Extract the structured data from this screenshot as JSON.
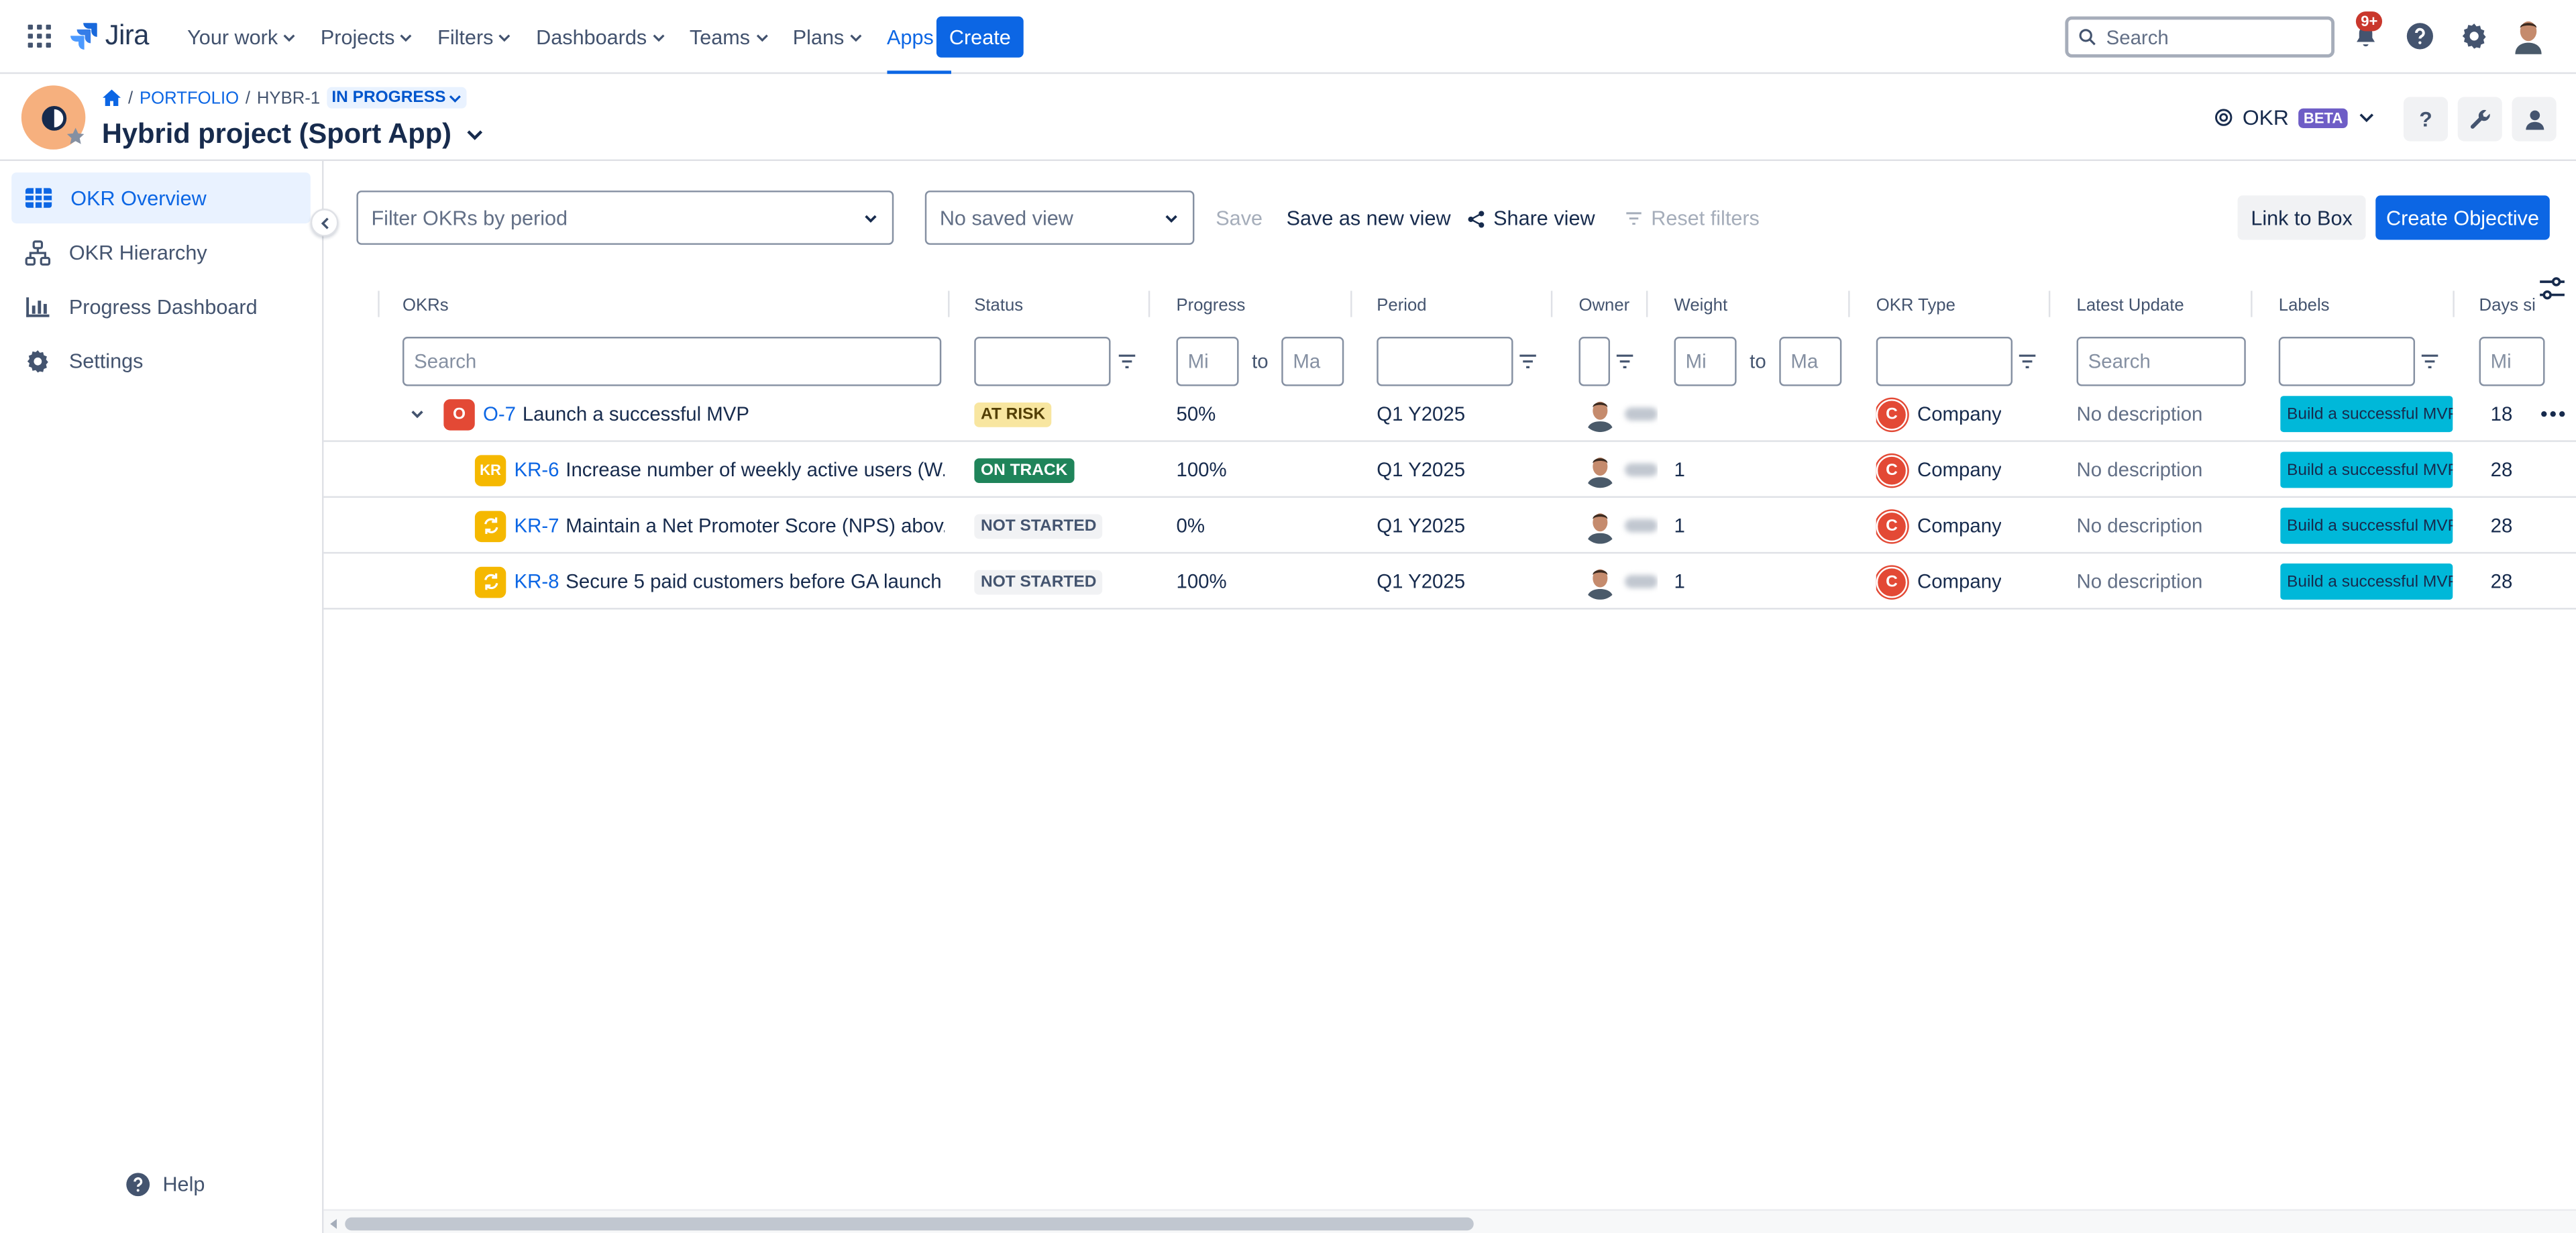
{
  "topnav": {
    "logo_text": "Jira",
    "items": [
      {
        "label": "Your work"
      },
      {
        "label": "Projects"
      },
      {
        "label": "Filters"
      },
      {
        "label": "Dashboards"
      },
      {
        "label": "Teams"
      },
      {
        "label": "Plans"
      },
      {
        "label": "Apps"
      }
    ],
    "active_item": "Apps",
    "create_label": "Create",
    "search_placeholder": "Search",
    "notifications_badge": "9+",
    "accent_color": "#0c66e4"
  },
  "header": {
    "breadcrumb": {
      "portfolio": "PORTFOLIO",
      "separator": "/",
      "issue_key": "HYBR-1",
      "status": "IN PROGRESS"
    },
    "title": "Hybrid project (Sport App)",
    "okr_label": "OKR",
    "beta_label": "BETA",
    "help_button": "?"
  },
  "sidebar": {
    "items": [
      {
        "label": "OKR Overview",
        "icon": "grid-icon",
        "active": true
      },
      {
        "label": "OKR Hierarchy",
        "icon": "hierarchy-icon",
        "active": false
      },
      {
        "label": "Progress Dashboard",
        "icon": "bar-chart-icon",
        "active": false
      },
      {
        "label": "Settings",
        "icon": "gear-icon",
        "active": false
      }
    ],
    "help_label": "Help"
  },
  "toolbar": {
    "period_placeholder": "Filter OKRs by period",
    "saved_view": "No saved view",
    "save_label": "Save",
    "save_new_label": "Save as new view",
    "share_label": "Share view",
    "reset_label": "Reset filters",
    "link_box_label": "Link to Box",
    "create_objective_label": "Create Objective"
  },
  "table": {
    "columns": [
      "OKRs",
      "Status",
      "Progress",
      "Period",
      "Owner",
      "Weight",
      "OKR Type",
      "Latest Update",
      "Labels",
      "Days si"
    ],
    "filters": {
      "okrs_placeholder": "Search",
      "progress_min": "Mi",
      "progress_max": "Ma",
      "to_label": "to",
      "weight_min": "Mi",
      "weight_max": "Ma",
      "latest_update_placeholder": "Search",
      "days_min": "Mi"
    },
    "rows": [
      {
        "type_icon": "O",
        "key": "O-7",
        "title": "Launch a successful MVP",
        "status": "AT RISK",
        "status_kind": "risk",
        "progress": "50%",
        "period": "Q1 Y2025",
        "weight": "",
        "okr_type": "Company",
        "okr_type_initial": "C",
        "latest_update": "No description",
        "label": "Build a successful MVP",
        "days": "18"
      },
      {
        "type_icon": "KR",
        "key": "KR-6",
        "title": "Increase number of weekly active users (W...",
        "status": "ON TRACK",
        "status_kind": "track",
        "progress": "100%",
        "period": "Q1 Y2025",
        "weight": "1",
        "okr_type": "Company",
        "okr_type_initial": "C",
        "latest_update": "No description",
        "label": "Build a successful MVP",
        "days": "28"
      },
      {
        "type_icon": "sync",
        "key": "KR-7",
        "title": "Maintain a Net Promoter Score (NPS) abov...",
        "status": "NOT STARTED",
        "status_kind": "not",
        "progress": "0%",
        "period": "Q1 Y2025",
        "weight": "1",
        "okr_type": "Company",
        "okr_type_initial": "C",
        "latest_update": "No description",
        "label": "Build a successful MVP",
        "days": "28"
      },
      {
        "type_icon": "sync",
        "key": "KR-8",
        "title": "Secure 5 paid customers before GA launch",
        "status": "NOT STARTED",
        "status_kind": "not",
        "progress": "100%",
        "period": "Q1 Y2025",
        "weight": "1",
        "okr_type": "Company",
        "okr_type_initial": "C",
        "latest_update": "No description",
        "label": "Build a successful MVP",
        "days": "28"
      }
    ]
  }
}
